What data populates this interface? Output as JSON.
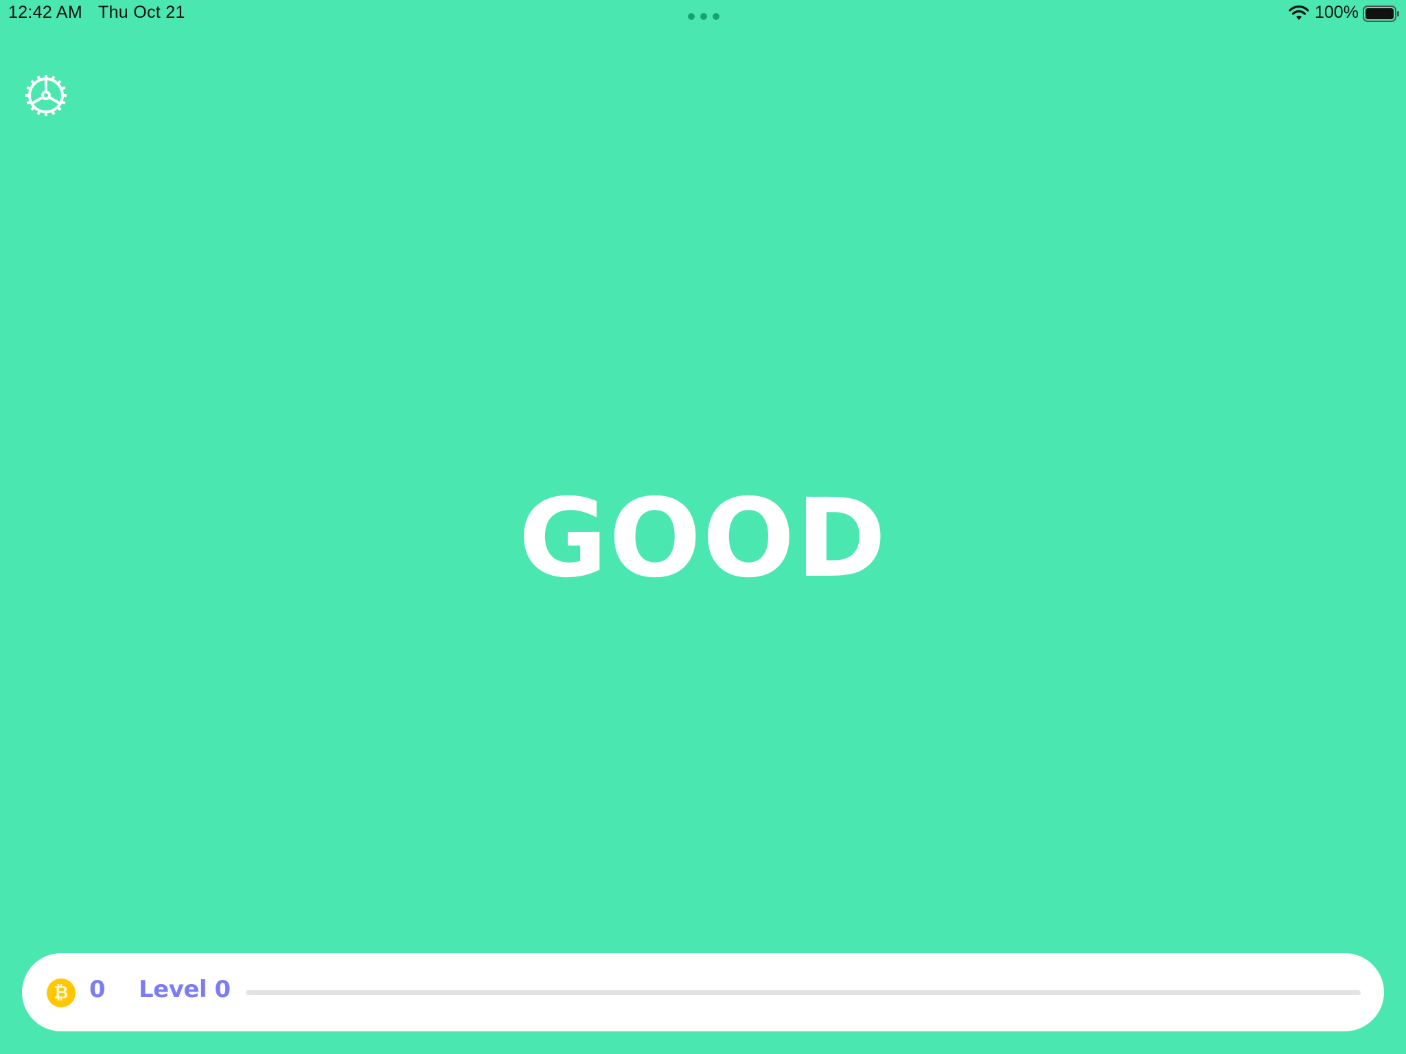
{
  "status_bar": {
    "time": "12:42 AM",
    "date": "Thu Oct 21",
    "battery_percent": "100%"
  },
  "main": {
    "word": "GOOD"
  },
  "bottom_bar": {
    "coin_symbol": "₿",
    "coin_count": "0",
    "level_label": "Level 0",
    "progress_fraction": 0
  },
  "colors": {
    "background": "#4AE7B1",
    "accent": "#7C7CF5",
    "coin": "#FFC700"
  },
  "icons": {
    "settings": "gear-icon",
    "wifi": "wifi-icon",
    "battery": "battery-icon",
    "coin": "bitcoin-coin-icon"
  }
}
